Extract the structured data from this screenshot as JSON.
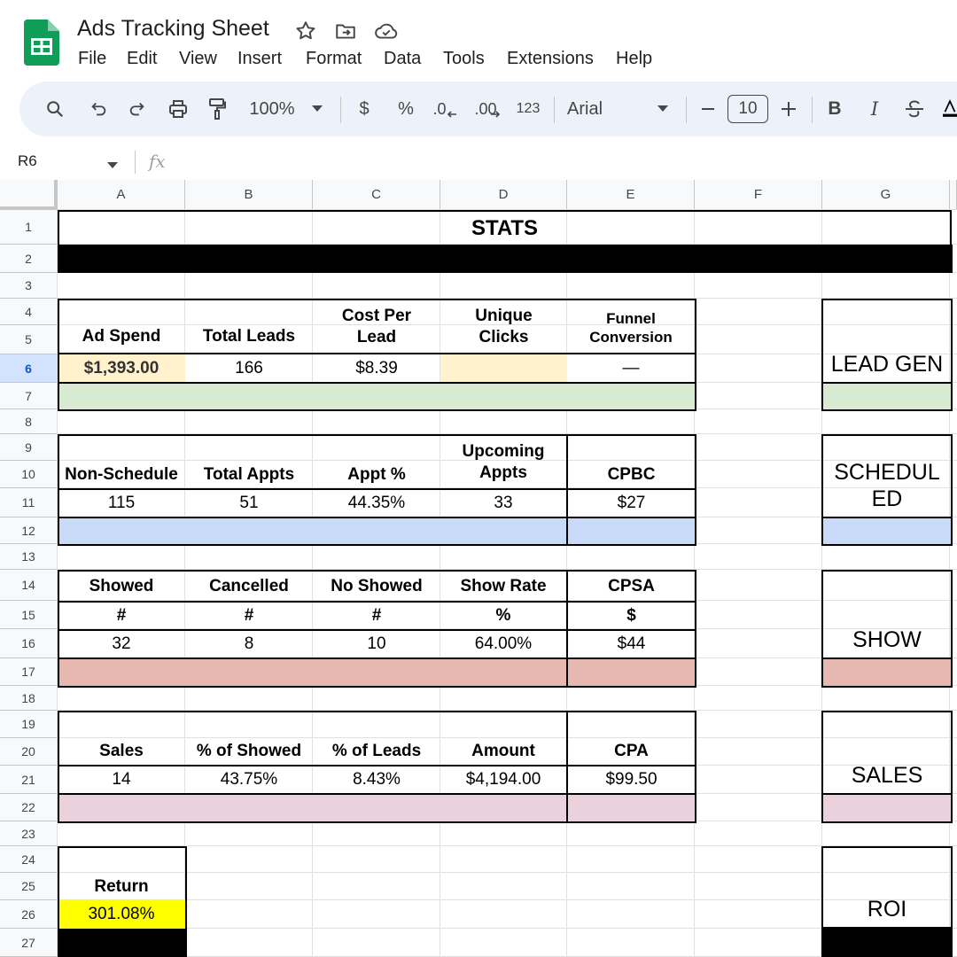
{
  "app": {
    "title": "Ads Tracking Sheet",
    "menu": [
      "File",
      "Edit",
      "View",
      "Insert",
      "Format",
      "Data",
      "Tools",
      "Extensions",
      "Help"
    ]
  },
  "toolbar": {
    "zoom": "100%",
    "currency": "$",
    "percent": "%",
    "dec_decrease": ".0",
    "dec_increase": ".00",
    "number_format": "123",
    "font": "Arial",
    "font_size": "10",
    "bold": "B",
    "italic": "I"
  },
  "formula_bar": {
    "name_box": "R6",
    "fx": "fx",
    "value": ""
  },
  "columns": [
    "A",
    "B",
    "C",
    "D",
    "E",
    "F",
    "G"
  ],
  "rows": [
    "1",
    "2",
    "3",
    "4",
    "5",
    "6",
    "7",
    "8",
    "9",
    "10",
    "11",
    "12",
    "13",
    "14",
    "15",
    "16",
    "17",
    "18",
    "19",
    "20",
    "21",
    "22",
    "23",
    "24",
    "25",
    "26",
    "27"
  ],
  "selected_row": "6",
  "colors": {
    "leadgen": "#d9ead3",
    "scheduled": "#c9daf8",
    "show": "#e6b8af",
    "sales": "#ead1dc",
    "highlight_cream": "#fff2cc",
    "return_yellow": "#ffff00",
    "black": "#000000"
  },
  "sheet": {
    "title": "STATS",
    "lead": {
      "headers": [
        "Ad Spend",
        "Total Leads",
        "Cost Per\nLead",
        "Unique\nClicks",
        "Funnel\nConversion"
      ],
      "values": [
        "$1,393.00",
        "166",
        "$8.39",
        "",
        "—"
      ]
    },
    "appts": {
      "headers": [
        "Non-Schedule",
        "Total Appts",
        "Appt %",
        "Upcoming\nAppts",
        "CPBC"
      ],
      "values": [
        "115",
        "51",
        "44.35%",
        "33",
        "$27"
      ]
    },
    "show": {
      "headers": [
        "Showed",
        "Cancelled",
        "No Showed",
        "Show Rate",
        "CPSA"
      ],
      "units": [
        "#",
        "#",
        "#",
        "%",
        "$"
      ],
      "values": [
        "32",
        "8",
        "10",
        "64.00%",
        "$44"
      ]
    },
    "sales": {
      "headers": [
        "Sales",
        "% of Showed",
        "% of Leads",
        "Amount",
        "CPA"
      ],
      "values": [
        "14",
        "43.75%",
        "8.43%",
        "$4,194.00",
        "$99.50"
      ]
    },
    "return": {
      "label": "Return",
      "value": "301.08%"
    },
    "side": [
      "LEAD GEN",
      "SCHEDUL\nED",
      "SHOW",
      "SALES",
      "ROI"
    ]
  }
}
